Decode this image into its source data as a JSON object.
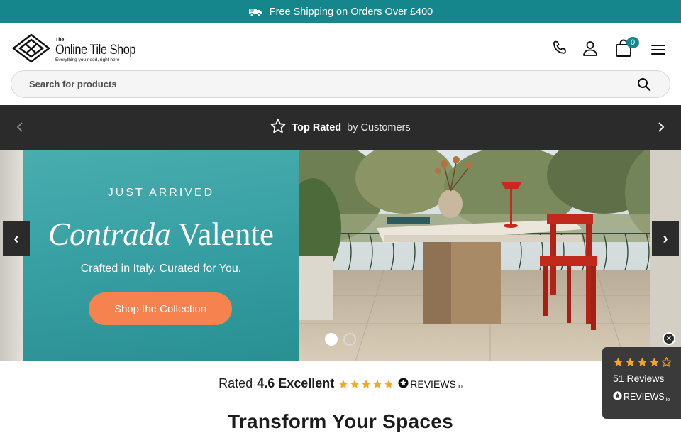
{
  "announcement": {
    "text": "Free Shipping on Orders Over £400",
    "icon": "truck-icon"
  },
  "header": {
    "logo": {
      "the": "The",
      "name": "Online Tile Shop",
      "tagline": "Everything you need, right here"
    },
    "cart_count": "0",
    "icons": [
      "phone-icon",
      "user-icon",
      "bag-icon",
      "menu-icon"
    ]
  },
  "search": {
    "placeholder": "Search for products"
  },
  "rated_strip": {
    "bold": "Top Rated",
    "light": "by Customers"
  },
  "hero": {
    "kicker": "JUST ARRIVED",
    "title_script": "Contrada",
    "title_serif": "Valente",
    "subtitle": "Crafted in Italy. Curated for You.",
    "cta": "Shop the Collection",
    "prev": "‹",
    "next": "›",
    "active_slide": 1,
    "slide_count": 2
  },
  "rating": {
    "prefix": "Rated",
    "score": "4.6 Excellent",
    "stars": 5,
    "brand": "REVIEWS",
    "brand_suffix": "io"
  },
  "section": {
    "title": "Transform Your Spaces"
  },
  "widget": {
    "stars": 4.5,
    "count": "51 Reviews",
    "brand": "REVIEWS",
    "brand_suffix": "io",
    "close": "✕"
  },
  "colors": {
    "teal": "#14868c",
    "dark": "#2b2b2b",
    "star": "#f5a623",
    "cta": "#f5824f"
  }
}
